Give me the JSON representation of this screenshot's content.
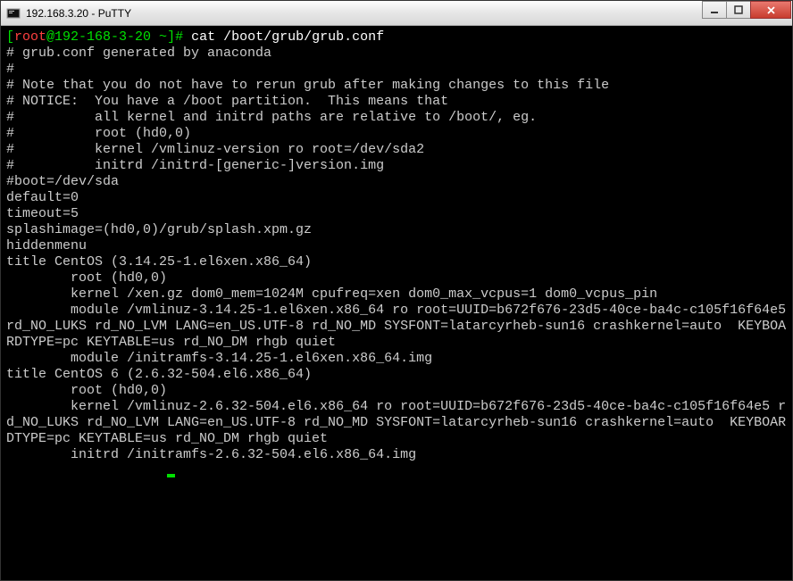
{
  "window": {
    "title": "192.168.3.20 - PuTTY"
  },
  "prompt": {
    "open": "[",
    "user": "root",
    "at_host": "@192-168-3-20 ~",
    "close": "]# ",
    "command": "cat /boot/grub/grub.conf"
  },
  "lines": [
    "# grub.conf generated by anaconda",
    "#",
    "# Note that you do not have to rerun grub after making changes to this file",
    "# NOTICE:  You have a /boot partition.  This means that",
    "#          all kernel and initrd paths are relative to /boot/, eg.",
    "#          root (hd0,0)",
    "#          kernel /vmlinuz-version ro root=/dev/sda2",
    "#          initrd /initrd-[generic-]version.img",
    "#boot=/dev/sda",
    "default=0",
    "timeout=5",
    "splashimage=(hd0,0)/grub/splash.xpm.gz",
    "hiddenmenu",
    "title CentOS (3.14.25-1.el6xen.x86_64)",
    "        root (hd0,0)",
    "        kernel /xen.gz dom0_mem=1024M cpufreq=xen dom0_max_vcpus=1 dom0_vcpus_pin",
    "        module /vmlinuz-3.14.25-1.el6xen.x86_64 ro root=UUID=b672f676-23d5-40ce-ba4c-c105f16f64e5 rd_NO_LUKS rd_NO_LVM LANG=en_US.UTF-8 rd_NO_MD SYSFONT=latarcyrheb-sun16 crashkernel=auto  KEYBOARDTYPE=pc KEYTABLE=us rd_NO_DM rhgb quiet",
    "        module /initramfs-3.14.25-1.el6xen.x86_64.img",
    "title CentOS 6 (2.6.32-504.el6.x86_64)",
    "        root (hd0,0)",
    "        kernel /vmlinuz-2.6.32-504.el6.x86_64 ro root=UUID=b672f676-23d5-40ce-ba4c-c105f16f64e5 rd_NO_LUKS rd_NO_LVM LANG=en_US.UTF-8 rd_NO_MD SYSFONT=latarcyrheb-sun16 crashkernel=auto  KEYBOARDTYPE=pc KEYTABLE=us rd_NO_DM rhgb quiet",
    "        initrd /initramfs-2.6.32-504.el6.x86_64.img"
  ]
}
